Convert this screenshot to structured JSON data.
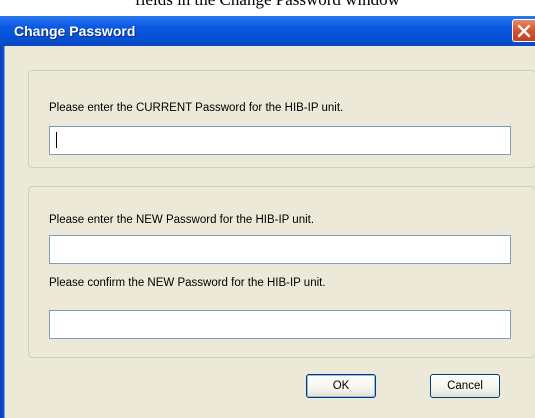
{
  "caption": "fields in the Change Password window",
  "window": {
    "title": "Change Password"
  },
  "current_group": {
    "label": "Please enter the CURRENT Password for the HIB-IP unit.",
    "input_value": ""
  },
  "new_group": {
    "new_label": "Please enter the NEW Password for the HIB-IP unit.",
    "new_value": "",
    "confirm_label": "Please confirm the NEW Password for the HIB-IP unit.",
    "confirm_value": ""
  },
  "buttons": {
    "ok_label": "OK",
    "cancel_label": "Cancel"
  },
  "colors": {
    "titlebar": "#0551d6",
    "dialog_face": "#ece9d8",
    "close_button": "#d6542f",
    "input_border": "#7f9db9"
  },
  "icons": {
    "close": "close-icon"
  }
}
